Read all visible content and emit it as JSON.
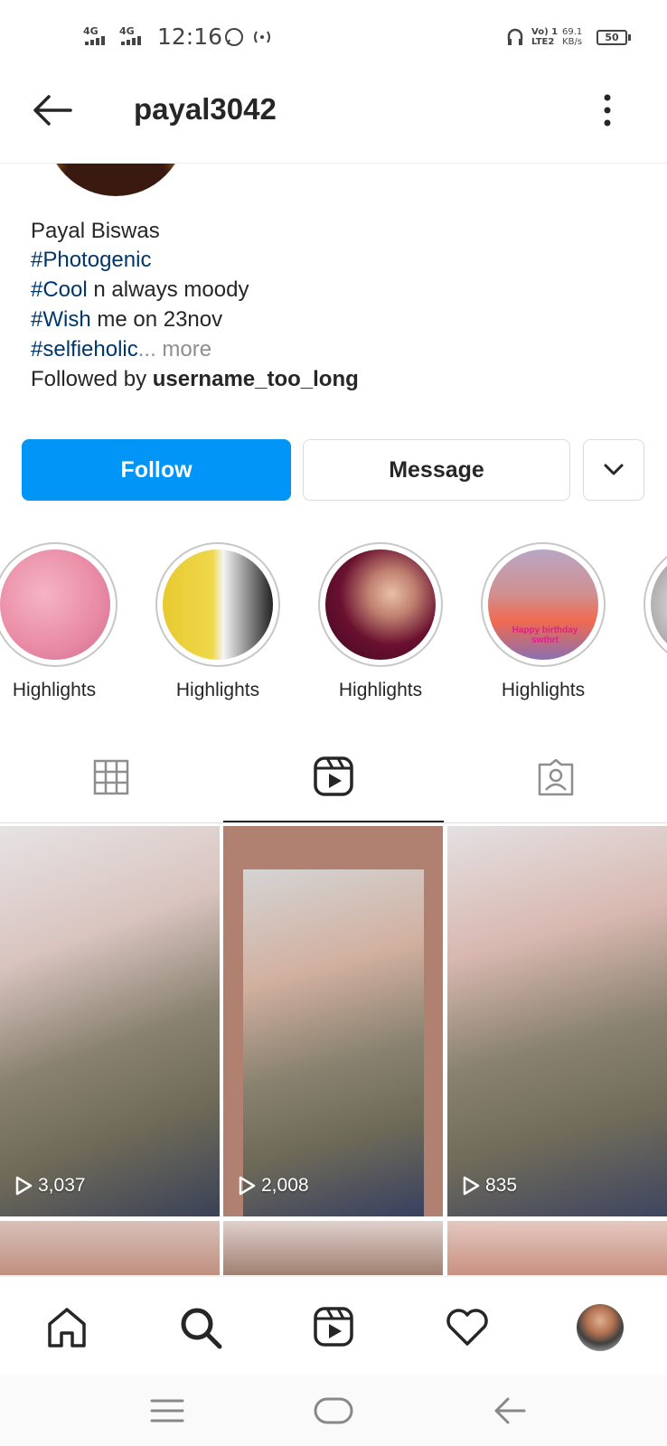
{
  "status_bar": {
    "network1": "4G",
    "network2": "4G",
    "time": "12:16",
    "volte": "Vo) 1",
    "lte": "LTE2",
    "speed_value": "69.1",
    "speed_unit": "KB/s",
    "battery": "50"
  },
  "header": {
    "username": "payal3042"
  },
  "profile": {
    "name": "Payal Biswas",
    "bio_line1_tag": "#Photogenic",
    "bio_line2_tag": "#Cool",
    "bio_line2_text": " n always moody",
    "bio_line3_tag": "#Wish",
    "bio_line3_text": " me on 23nov",
    "bio_line4_tag": "#selfieholic",
    "bio_line4_more": "... more",
    "followed_by_prefix": "Followed by ",
    "followed_by_user": "username_too_long"
  },
  "actions": {
    "follow_label": "Follow",
    "message_label": "Message"
  },
  "highlights": [
    {
      "label": "Highlights"
    },
    {
      "label": "Highlights"
    },
    {
      "label": "Highlights"
    },
    {
      "label": "Highlights"
    },
    {
      "label": "H"
    }
  ],
  "highlight_overlay_text": "Happy birthday swthrt",
  "tabs": [
    {
      "icon": "grid-icon",
      "active": false
    },
    {
      "icon": "reels-icon",
      "active": true
    },
    {
      "icon": "tagged-icon",
      "active": false
    }
  ],
  "reels": [
    {
      "views": "3,037"
    },
    {
      "views": "2,008"
    },
    {
      "views": "835"
    }
  ],
  "bottom_nav": [
    "home-icon",
    "search-icon",
    "reels-icon",
    "heart-icon",
    "profile-avatar"
  ],
  "colors": {
    "accent": "#0095f6",
    "hashtag": "#00376b",
    "muted": "#8e8e8e"
  }
}
